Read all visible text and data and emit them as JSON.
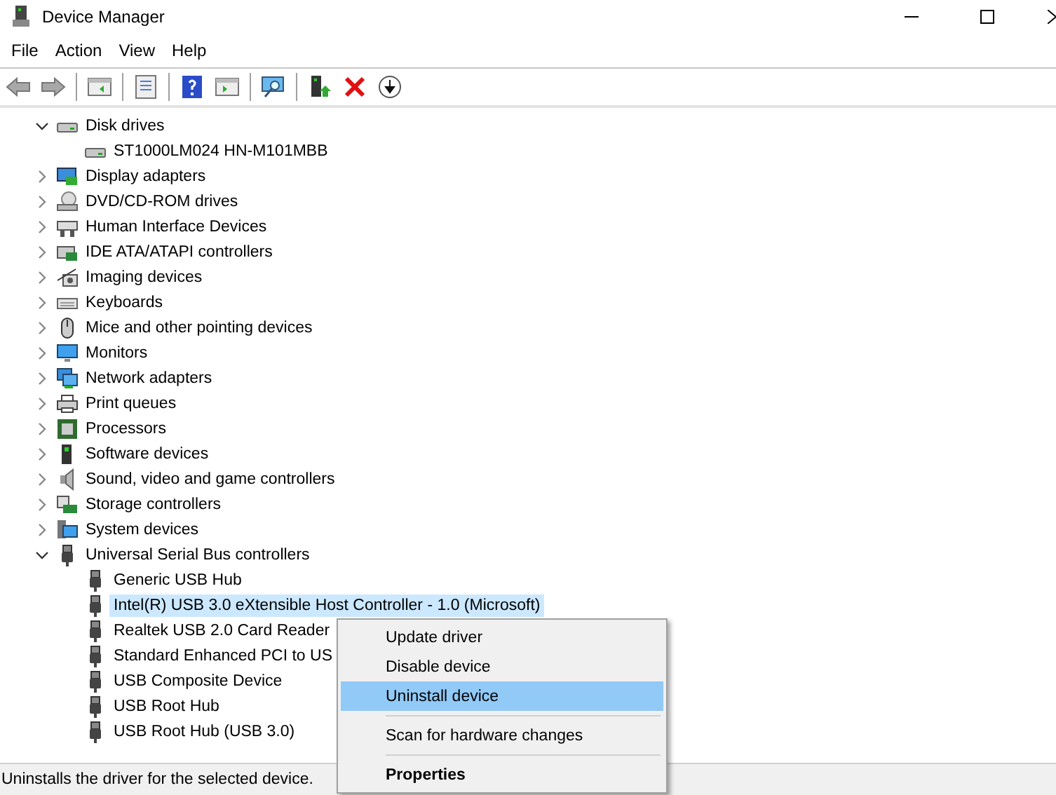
{
  "window": {
    "title": "Device Manager"
  },
  "menu": [
    "File",
    "Action",
    "View",
    "Help"
  ],
  "toolbar": [
    {
      "kind": "back",
      "disabled": true
    },
    {
      "kind": "forward",
      "disabled": true
    },
    {
      "kind": "sep"
    },
    {
      "kind": "tree"
    },
    {
      "kind": "sep"
    },
    {
      "kind": "props"
    },
    {
      "kind": "sep"
    },
    {
      "kind": "help"
    },
    {
      "kind": "pane"
    },
    {
      "kind": "sep"
    },
    {
      "kind": "scan"
    },
    {
      "kind": "sep"
    },
    {
      "kind": "update"
    },
    {
      "kind": "remove"
    },
    {
      "kind": "download"
    }
  ],
  "tree": [
    {
      "label": "Disk drives",
      "kind": "drive",
      "expanded": true,
      "children": [
        {
          "label": "ST1000LM024 HN-M101MBB",
          "kind": "drive",
          "selected": false
        }
      ]
    },
    {
      "label": "Display adapters",
      "kind": "display",
      "expanded": false
    },
    {
      "label": "DVD/CD-ROM drives",
      "kind": "disc",
      "expanded": false
    },
    {
      "label": "Human Interface Devices",
      "kind": "hid",
      "expanded": false
    },
    {
      "label": "IDE ATA/ATAPI controllers",
      "kind": "card",
      "expanded": false
    },
    {
      "label": "Imaging devices",
      "kind": "camera",
      "expanded": false
    },
    {
      "label": "Keyboards",
      "kind": "keyboard",
      "expanded": false
    },
    {
      "label": "Mice and other pointing devices",
      "kind": "mouse",
      "expanded": false
    },
    {
      "label": "Monitors",
      "kind": "monitor",
      "expanded": false
    },
    {
      "label": "Network adapters",
      "kind": "network",
      "expanded": false
    },
    {
      "label": "Print queues",
      "kind": "printer",
      "expanded": false
    },
    {
      "label": "Processors",
      "kind": "cpu",
      "expanded": false
    },
    {
      "label": "Software devices",
      "kind": "software",
      "expanded": false
    },
    {
      "label": "Sound, video and game controllers",
      "kind": "sound",
      "expanded": false
    },
    {
      "label": "Storage controllers",
      "kind": "storage",
      "expanded": false
    },
    {
      "label": "System devices",
      "kind": "system",
      "expanded": false
    },
    {
      "label": "Universal Serial Bus controllers",
      "kind": "usb",
      "expanded": true,
      "children": [
        {
          "label": "Generic USB Hub",
          "kind": "usb",
          "selected": false
        },
        {
          "label": "Intel(R) USB 3.0 eXtensible Host Controller - 1.0 (Microsoft)",
          "kind": "usb",
          "selected": true
        },
        {
          "label": "Realtek USB 2.0 Card Reader",
          "kind": "usb",
          "selected": false
        },
        {
          "label": "Standard Enhanced PCI to US",
          "kind": "usb",
          "selected": false
        },
        {
          "label": "USB Composite Device",
          "kind": "usb",
          "selected": false
        },
        {
          "label": "USB Root Hub",
          "kind": "usb",
          "selected": false
        },
        {
          "label": "USB Root Hub (USB 3.0)",
          "kind": "usb",
          "selected": false
        }
      ]
    }
  ],
  "context_menu": [
    {
      "kind": "item",
      "label": "Update driver",
      "selected": false
    },
    {
      "kind": "item",
      "label": "Disable device",
      "selected": false
    },
    {
      "kind": "item",
      "label": "Uninstall device",
      "selected": true
    },
    {
      "kind": "separator"
    },
    {
      "kind": "item",
      "label": "Scan for hardware changes",
      "selected": false
    },
    {
      "kind": "separator"
    },
    {
      "kind": "default",
      "label": "Properties",
      "selected": false
    }
  ],
  "status_bar": "Uninstalls the driver for the selected device."
}
